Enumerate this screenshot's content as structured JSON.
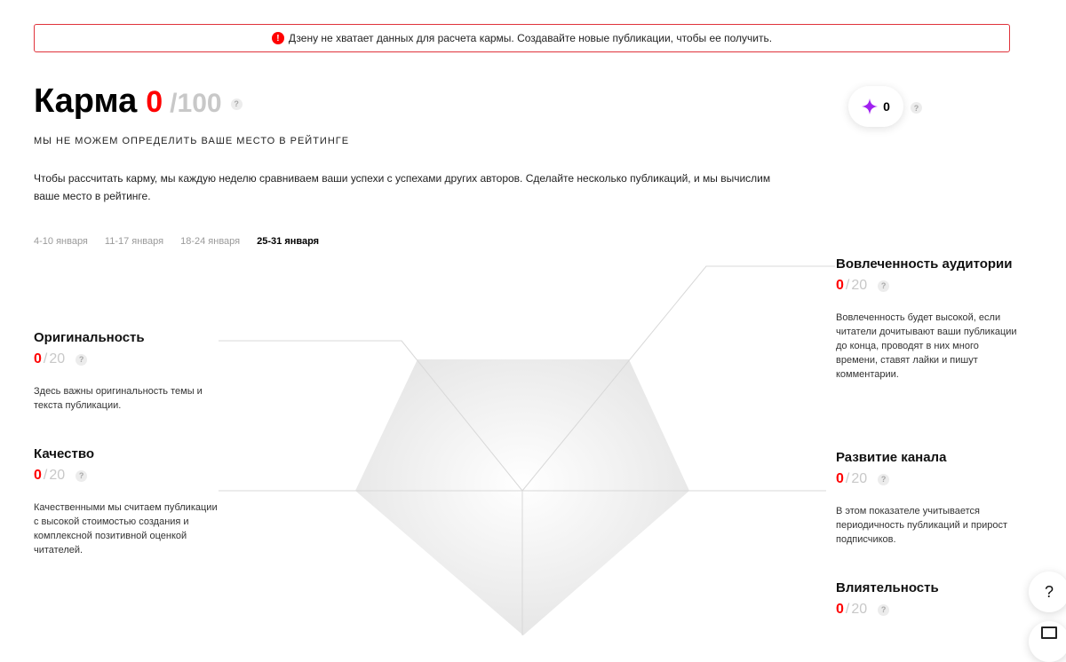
{
  "alert": {
    "icon": "alert-icon",
    "text": "Дзену не хватает данных для расчета кармы. Создавайте новые публикации, чтобы ее получить."
  },
  "karma": {
    "title": "Карма",
    "score": "0",
    "max": "/100",
    "subtitle": "МЫ НЕ МОЖЕМ ОПРЕДЕЛИТЬ ВАШЕ МЕСТО В РЕЙТИНГЕ",
    "description": "Чтобы рассчитать карму, мы каждую неделю сравниваем ваши успехи с успехами других авторов. Сделайте несколько публикаций, и мы вычислим ваше место в рейтинге."
  },
  "badge": {
    "icon": "diamond-icon",
    "value": "0"
  },
  "weeks": [
    {
      "label": "4-10 января",
      "active": false
    },
    {
      "label": "11-17 января",
      "active": false
    },
    {
      "label": "18-24 января",
      "active": false
    },
    {
      "label": "25-31 января",
      "active": true
    }
  ],
  "metrics": {
    "originality": {
      "title": "Оригинальность",
      "value": "0",
      "sep": "/",
      "max": "20",
      "description": "Здесь важны оригинальность темы и текста публикации."
    },
    "quality": {
      "title": "Качество",
      "value": "0",
      "sep": "/",
      "max": "20",
      "description": "Качественными мы считаем публикации с высокой стоимостью создания и комплексной позитивной оценкой читателей."
    },
    "engagement": {
      "title": "Вовлеченность аудитории",
      "value": "0",
      "sep": "/",
      "max": "20",
      "description": "Вовлеченность будет высокой, если читатели дочитывают ваши публикации до конца, проводят в них много времени, ставят лайки и пишут комментарии."
    },
    "growth": {
      "title": "Развитие канала",
      "value": "0",
      "sep": "/",
      "max": "20",
      "description": "В этом показателе учитывается периодичность публикаций и прирост подписчиков."
    },
    "influence": {
      "title": "Влиятельность",
      "value": "0",
      "sep": "/",
      "max": "20"
    }
  },
  "help_glyph": "?",
  "colors": {
    "accent": "#ff0000",
    "muted": "#c8c8c8",
    "alert_border": "#e0333b",
    "diamond": "#a020f0"
  }
}
